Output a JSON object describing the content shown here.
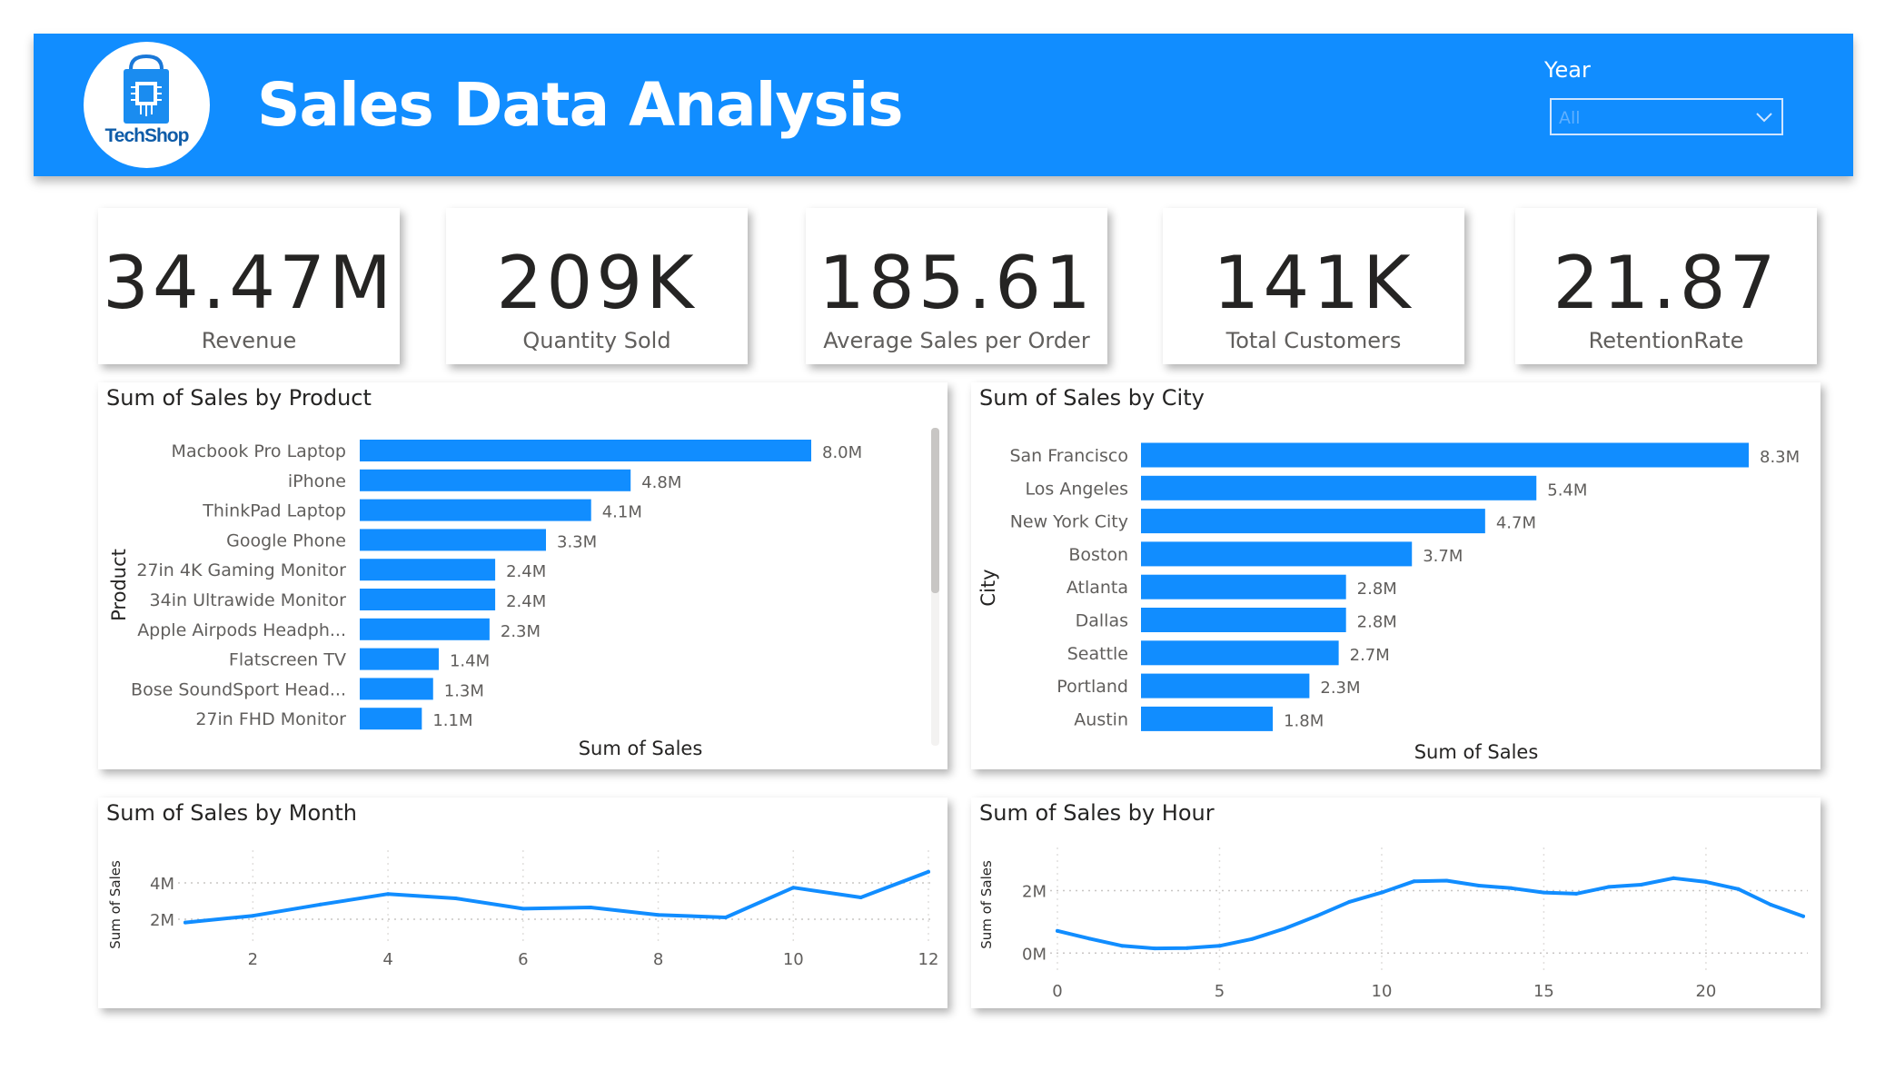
{
  "header": {
    "title": "Sales Data Analysis",
    "logo_text": "TechShop",
    "year_filter": {
      "label": "Year",
      "selected": "All"
    }
  },
  "kpis": [
    {
      "value": "34.47M",
      "label": "Revenue"
    },
    {
      "value": "209K",
      "label": "Quantity Sold"
    },
    {
      "value": "185.61",
      "label": "Average Sales per Order"
    },
    {
      "value": "141K",
      "label": "Total Customers"
    },
    {
      "value": "21.87",
      "label": "RetentionRate"
    }
  ],
  "colors": {
    "accent": "#118dff",
    "bar": "#118dff",
    "text": "#252423",
    "muted": "#605e5c"
  },
  "chart_data": [
    {
      "title": "Sum of Sales by Product",
      "type": "bar",
      "orientation": "horizontal",
      "ylabel": "Product",
      "xlabel": "Sum of Sales",
      "categories": [
        "Macbook Pro Laptop",
        "iPhone",
        "ThinkPad Laptop",
        "Google Phone",
        "27in 4K Gaming Monitor",
        "34in Ultrawide Monitor",
        "Apple Airpods Headph...",
        "Flatscreen TV",
        "Bose SoundSport Head...",
        "27in FHD Monitor"
      ],
      "values": [
        8.0,
        4.8,
        4.1,
        3.3,
        2.4,
        2.4,
        2.3,
        1.4,
        1.3,
        1.1
      ],
      "value_labels": [
        "8.0M",
        "4.8M",
        "4.1M",
        "3.3M",
        "2.4M",
        "2.4M",
        "2.3M",
        "1.4M",
        "1.3M",
        "1.1M"
      ],
      "unit": "M",
      "scrollbar": true
    },
    {
      "title": "Sum of Sales by City",
      "type": "bar",
      "orientation": "horizontal",
      "ylabel": "City",
      "xlabel": "Sum of Sales",
      "categories": [
        "San Francisco",
        "Los Angeles",
        "New York City",
        "Boston",
        "Atlanta",
        "Dallas",
        "Seattle",
        "Portland",
        "Austin"
      ],
      "values": [
        8.3,
        5.4,
        4.7,
        3.7,
        2.8,
        2.8,
        2.7,
        2.3,
        1.8
      ],
      "value_labels": [
        "8.3M",
        "5.4M",
        "4.7M",
        "3.7M",
        "2.8M",
        "2.8M",
        "2.7M",
        "2.3M",
        "1.8M"
      ],
      "unit": "M"
    },
    {
      "title": "Sum of Sales by Month",
      "type": "line",
      "ylabel": "Sum of Sales",
      "x": [
        1,
        2,
        3,
        4,
        5,
        6,
        7,
        8,
        9,
        10,
        11,
        12
      ],
      "y": [
        1.82,
        2.19,
        2.81,
        3.39,
        3.15,
        2.58,
        2.65,
        2.24,
        2.1,
        3.74,
        3.2,
        4.61
      ],
      "xticks": [
        "2",
        "4",
        "6",
        "8",
        "10",
        "12"
      ],
      "yticks": [
        "2M",
        "4M"
      ],
      "grid": true
    },
    {
      "title": "Sum of Sales by Hour",
      "type": "line",
      "ylabel": "Sum of Sales",
      "x": [
        0,
        1,
        2,
        3,
        4,
        5,
        6,
        7,
        8,
        9,
        10,
        11,
        12,
        13,
        14,
        15,
        16,
        17,
        18,
        19,
        20,
        21,
        22,
        23
      ],
      "y": [
        0.71,
        0.46,
        0.23,
        0.15,
        0.16,
        0.23,
        0.45,
        0.78,
        1.19,
        1.64,
        1.94,
        2.3,
        2.32,
        2.16,
        2.08,
        1.94,
        1.9,
        2.12,
        2.19,
        2.4,
        2.28,
        2.05,
        1.55,
        1.18
      ],
      "xticks": [
        "0",
        "5",
        "10",
        "15",
        "20"
      ],
      "yticks": [
        "0M",
        "2M"
      ],
      "grid": true
    }
  ]
}
